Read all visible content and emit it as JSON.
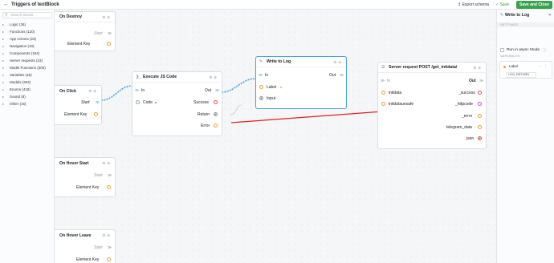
{
  "topbar": {
    "back_icon": "arrow-left-icon",
    "title": "Triggers of textBlock",
    "export_label": "Export schema",
    "save_label": "Save",
    "save_close_label": "Save and Close"
  },
  "sidebar": {
    "search_placeholder": "Search blocks",
    "categories": [
      {
        "label": "Logic (36)"
      },
      {
        "label": "Functions (120)"
      },
      {
        "label": "App Actions (23)"
      },
      {
        "label": "Navigation (10)"
      },
      {
        "label": "Components (194)"
      },
      {
        "label": "Server requests (23)"
      },
      {
        "label": "Model Functions (306)"
      },
      {
        "label": "Variables (45)"
      },
      {
        "label": "Models (304)"
      },
      {
        "label": "Enums (418)"
      },
      {
        "label": "Sound (8)"
      },
      {
        "label": "Other (16)"
      }
    ]
  },
  "nodes": {
    "on_destroy": {
      "title": "On Destroy",
      "start": "Start",
      "element_key": "Element Key"
    },
    "on_click": {
      "title": "On Click",
      "start": "Start",
      "element_key": "Element Key"
    },
    "on_hover_start": {
      "title": "On Hover Start",
      "start": "Start",
      "element_key": "Element Key"
    },
    "on_hover_leave": {
      "title": "On Hover Leave",
      "start": "Start",
      "element_key": "Element Key"
    },
    "execute_js": {
      "title": "Execute JS Code",
      "in": "In",
      "out": "Out",
      "code": "Code",
      "success": "Success",
      "return": "Return",
      "error": "Error"
    },
    "write_log": {
      "title": "Write to Log",
      "in": "In",
      "out": "Out",
      "label": "Label",
      "input": "Input"
    },
    "server_request": {
      "title": "Server request POST /get_initdata/",
      "in": "In",
      "out": "Out",
      "initdata": "initdata",
      "initdataunsafe": "initdataunsafe",
      "success": "_success",
      "httpcode": "_httpcode",
      "error": "_error",
      "telegram_data": "telegram_data",
      "json": "json"
    }
  },
  "rpanel": {
    "title": "Write to Log",
    "settings_header": "SETTINGS",
    "async_label": "Run in async Mode",
    "variables_header": "VARIABLES",
    "var_label": "Label",
    "var_value": "LOG_RETURN"
  },
  "colors": {
    "accent_blue": "#4a9fdc",
    "save_green": "#3aa24f",
    "port_orange": "#f0a030",
    "port_red": "#e0524e",
    "wire_red": "#e02020"
  }
}
